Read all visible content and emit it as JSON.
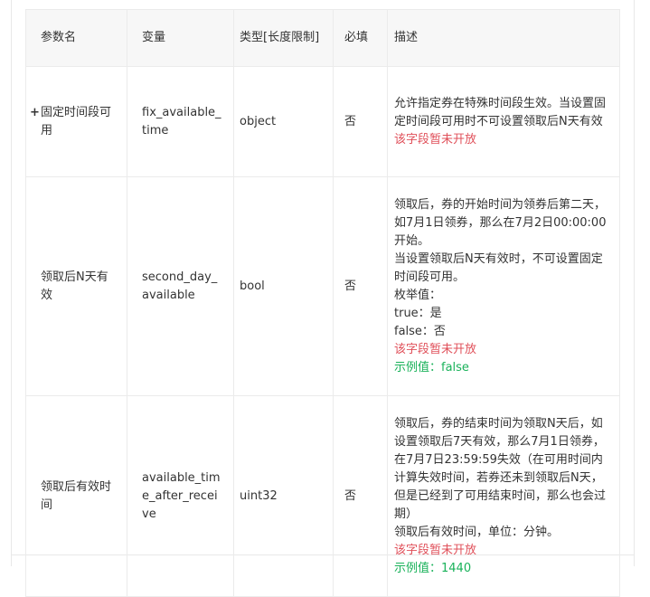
{
  "headers": {
    "param_name": "参数名",
    "variable": "变量",
    "type": "类型[长度限制]",
    "required": "必填",
    "description": "描述"
  },
  "rows": [
    {
      "expand_icon": "+",
      "param_name": "固定时间段可用",
      "variable": "fix_available_time",
      "type": "object",
      "required": "否",
      "desc_lines": [
        "允许指定券在特殊时间段生效。当设置固定时间段可用时不可设置领取后N天有效"
      ],
      "warning": "该字段暂未开放",
      "example": ""
    },
    {
      "param_name": "领取后N天有效",
      "variable": "second_day_available",
      "type": "bool",
      "required": "否",
      "desc_lines": [
        "领取后，券的开始时间为领券后第二天，如7月1日领券，那么在7月2日00:00:00开始。",
        "当设置领取后N天有效时，不可设置固定时间段可用。",
        "枚举值：",
        "true：是",
        "false：否"
      ],
      "warning": "该字段暂未开放",
      "example": "示例值：false"
    },
    {
      "param_name": "领取后有效时间",
      "variable": "available_time_after_receive",
      "type": "uint32",
      "required": "否",
      "desc_lines": [
        "领取后，券的结束时间为领取N天后，如设置领取后7天有效，那么7月1日领券，在7月7日23:59:59失效（在可用时间内计算失效时间，若券还未到领取后N天，但是已经到了可用结束时间，那么也会过期）",
        "领取后有效时间，单位：分钟。"
      ],
      "warning": "该字段暂未开放",
      "example": "示例值：1440"
    }
  ],
  "colors": {
    "warning": "#e0505a",
    "example": "#19b25a",
    "header_bg": "#f7f7f7",
    "border": "#ebebeb"
  }
}
